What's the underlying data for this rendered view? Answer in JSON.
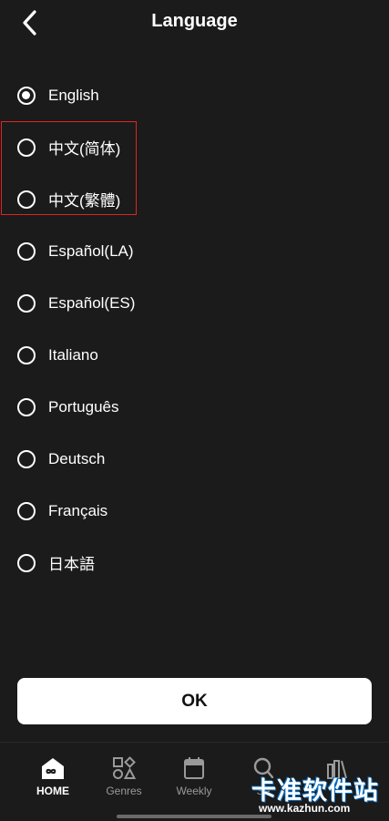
{
  "header": {
    "title": "Language",
    "back_icon": "chevron-left-icon"
  },
  "languages": [
    {
      "label": "English",
      "selected": true
    },
    {
      "label": "中文(简体)",
      "selected": false
    },
    {
      "label": "中文(繁體)",
      "selected": false
    },
    {
      "label": "Español(LA)",
      "selected": false
    },
    {
      "label": "Español(ES)",
      "selected": false
    },
    {
      "label": "Italiano",
      "selected": false
    },
    {
      "label": "Português",
      "selected": false
    },
    {
      "label": "Deutsch",
      "selected": false
    },
    {
      "label": "Français",
      "selected": false
    },
    {
      "label": "日本語",
      "selected": false
    }
  ],
  "ok_button": {
    "label": "OK"
  },
  "bottom_nav": {
    "items": [
      {
        "label": "HOME",
        "icon": "home-icon",
        "active": true
      },
      {
        "label": "Genres",
        "icon": "genres-icon",
        "active": false
      },
      {
        "label": "Weekly",
        "icon": "calendar-icon",
        "active": false
      },
      {
        "label": "Se",
        "icon": "search-icon",
        "active": false
      },
      {
        "label": "",
        "icon": "library-icon",
        "active": false
      }
    ]
  },
  "watermark": {
    "text": "卡准软件站",
    "url": "www.kazhun.com"
  },
  "colors": {
    "background": "#1b1b1b",
    "highlight_border": "#e02424",
    "text": "#ffffff",
    "nav_inactive": "#9a9a9a"
  }
}
